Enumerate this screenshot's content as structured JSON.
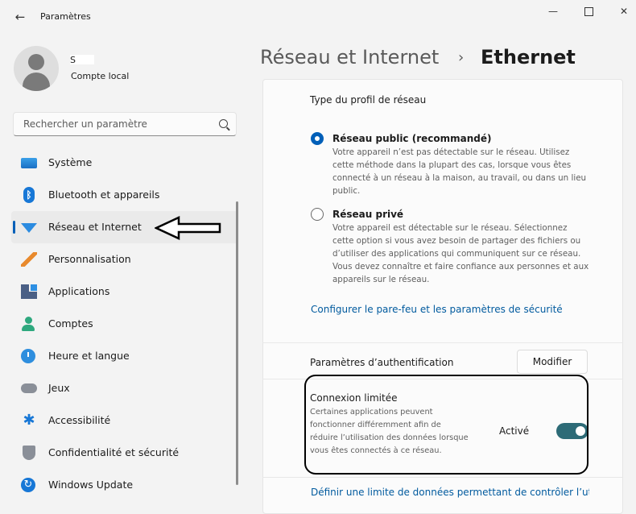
{
  "window": {
    "title": "Paramètres",
    "back_icon": "←",
    "minimize_icon": "—",
    "close_icon": "✕"
  },
  "account": {
    "name": "S",
    "type": "Compte local"
  },
  "search": {
    "placeholder": "Rechercher un paramètre"
  },
  "nav": {
    "items": [
      {
        "label": "Système",
        "icon": "monitor-icon"
      },
      {
        "label": "Bluetooth et appareils",
        "icon": "bluetooth-icon"
      },
      {
        "label": "Réseau et Internet",
        "icon": "wifi-icon",
        "active": true
      },
      {
        "label": "Personnalisation",
        "icon": "brush-icon"
      },
      {
        "label": "Applications",
        "icon": "apps-icon"
      },
      {
        "label": "Comptes",
        "icon": "user-icon"
      },
      {
        "label": "Heure et langue",
        "icon": "clock-icon"
      },
      {
        "label": "Jeux",
        "icon": "gamepad-icon"
      },
      {
        "label": "Accessibilité",
        "icon": "accessibility-icon"
      },
      {
        "label": "Confidentialité et sécurité",
        "icon": "shield-icon"
      },
      {
        "label": "Windows Update",
        "icon": "update-icon"
      }
    ]
  },
  "breadcrumb": {
    "parent": "Réseau et Internet",
    "separator": "›",
    "current": "Ethernet"
  },
  "profile": {
    "title": "Type du profil de réseau",
    "options": [
      {
        "label": "Réseau public (recommandé)",
        "checked": true,
        "description": "Votre appareil n’est pas détectable sur le réseau. Utilisez cette méthode dans la plupart des cas, lorsque vous êtes connecté à un réseau à la maison, au travail, ou dans un lieu public."
      },
      {
        "label": "Réseau privé",
        "checked": false,
        "description": "Votre appareil est détectable sur le réseau. Sélectionnez cette option si vous avez besoin de partager des fichiers ou d’utiliser des applications qui communiquent sur ce réseau. Vous devez connaître et faire confiance aux personnes et aux appareils sur le réseau."
      }
    ],
    "firewall_link": "Configurer le pare-feu et les paramètres de sécurité"
  },
  "auth": {
    "label": "Paramètres d’authentification",
    "button": "Modifier"
  },
  "metered": {
    "title": "Connexion limitée",
    "description": "Certaines applications peuvent fonctionner différemment afin de réduire l’utilisation des données lorsque vous êtes connectés à ce réseau.",
    "state": "Activé",
    "on": true
  },
  "data_limit_link": "Définir une limite de données permettant de contrôler l’utilisation des données sur ce réseau",
  "colors": {
    "accent": "#005fb8",
    "toggle_on": "#2d6b77",
    "link": "#005a9e"
  }
}
